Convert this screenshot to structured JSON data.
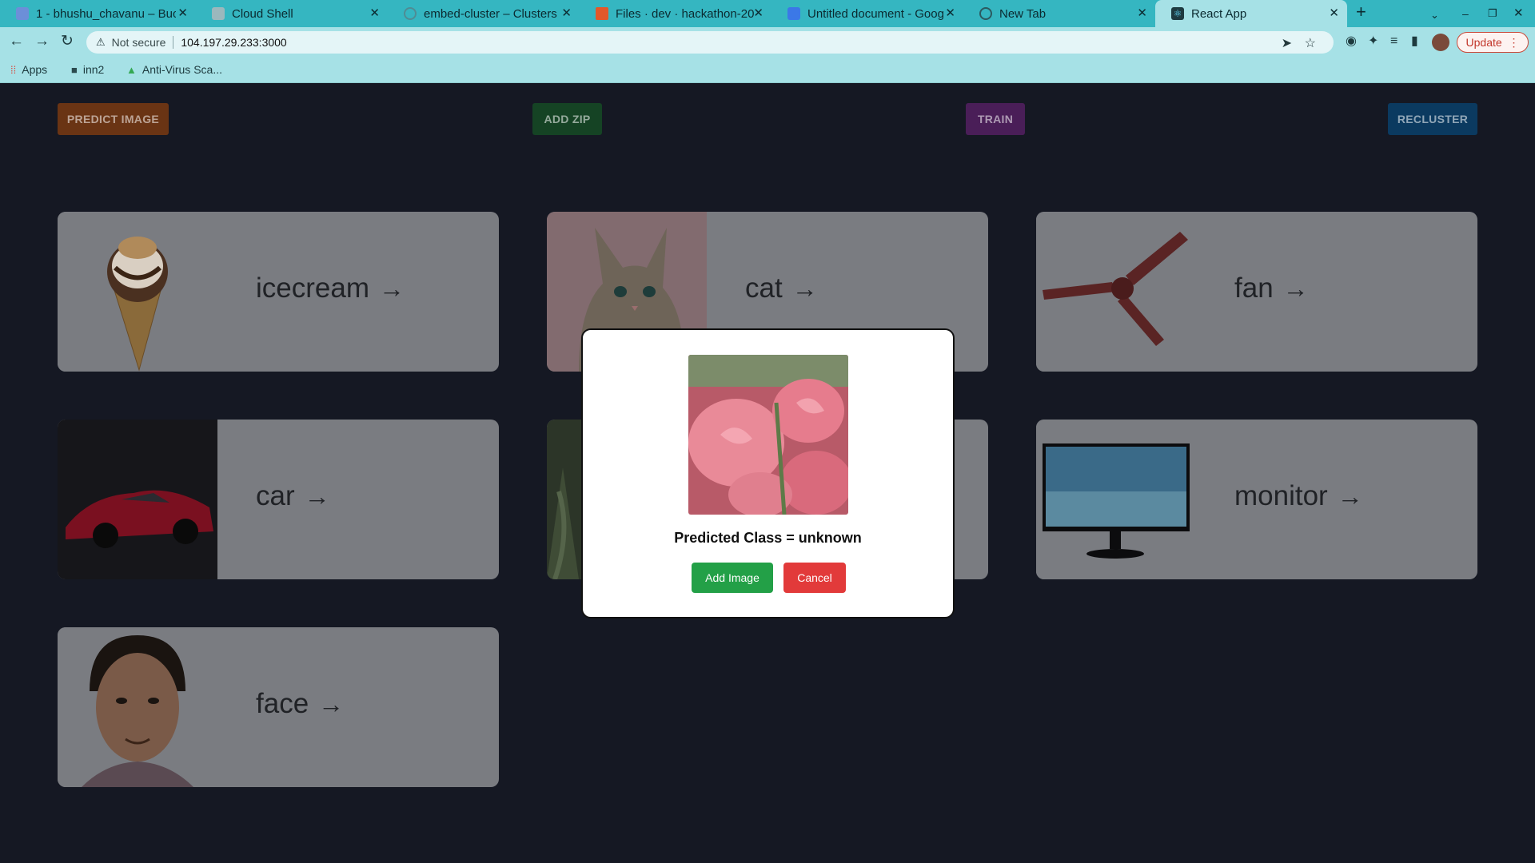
{
  "browser": {
    "tabs": [
      {
        "label": "1 - bhushu_chavanu – Buc",
        "icon": "doc-icon"
      },
      {
        "label": "Cloud Shell",
        "icon": "cloud-shell-icon"
      },
      {
        "label": "embed-cluster – Clusters",
        "icon": "cluster-icon"
      },
      {
        "label": "Files · dev · hackathon-20",
        "icon": "gitlab-icon"
      },
      {
        "label": "Untitled document - Goog",
        "icon": "docs-icon"
      },
      {
        "label": "New Tab",
        "icon": "globe-icon"
      },
      {
        "label": "React App",
        "icon": "react-icon"
      }
    ],
    "not_secure": "Not secure",
    "url": "104.197.29.233:3000",
    "update_label": "Update",
    "bookmarks": [
      {
        "label": "Apps",
        "icon": "apps-grid-icon"
      },
      {
        "label": "inn2",
        "icon": "folder-icon"
      },
      {
        "label": "Anti-Virus Sca...",
        "icon": "drive-icon"
      }
    ]
  },
  "toolbar": {
    "predict_label": "PREDICT IMAGE",
    "add_zip_label": "ADD ZIP",
    "train_label": "TRAIN",
    "recluster_label": "RECLUSTER"
  },
  "clusters": [
    {
      "label": "icecream",
      "image": "ice-cream-cone"
    },
    {
      "label": "cat",
      "image": "kitten"
    },
    {
      "label": "fan",
      "image": "ceiling-fan"
    },
    {
      "label": "car",
      "image": "red-sports-car"
    },
    {
      "label": "",
      "image": "plant"
    },
    {
      "label": "monitor",
      "image": "computer-monitor"
    },
    {
      "label": "face",
      "image": "man-portrait"
    }
  ],
  "modal": {
    "image": "pink-roses",
    "predicted_text": "Predicted Class = unknown",
    "add_label": "Add Image",
    "cancel_label": "Cancel"
  },
  "colors": {
    "predict": "#b3541e",
    "add_zip": "#1f5a2e",
    "train": "#6a2a7e",
    "recluster": "#0d4d80",
    "add_image": "#23a047",
    "cancel": "#e23a3a"
  }
}
